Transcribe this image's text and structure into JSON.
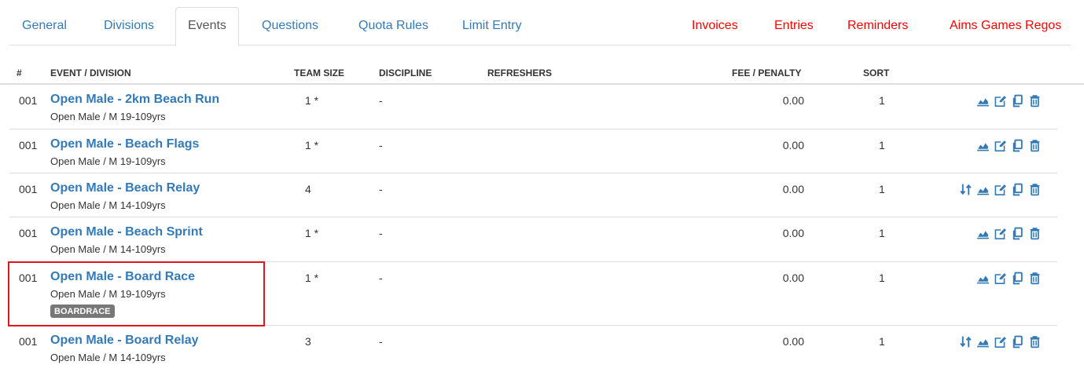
{
  "tabs": [
    {
      "label": "General"
    },
    {
      "label": "Divisions"
    },
    {
      "label": "Events"
    },
    {
      "label": "Questions"
    },
    {
      "label": "Quota Rules"
    },
    {
      "label": "Limit Entry"
    }
  ],
  "right_tabs": [
    {
      "label": "Invoices"
    },
    {
      "label": "Entries"
    },
    {
      "label": "Reminders"
    },
    {
      "label": "Aims Games Regos"
    }
  ],
  "table": {
    "headers": {
      "num": "#",
      "event": "EVENT / DIVISION",
      "team_size": "TEAM SIZE",
      "discipline": "DISCIPLINE",
      "refreshers": "REFRESHERS",
      "fee": "FEE / PENALTY",
      "sort": "SORT"
    },
    "rows": [
      {
        "num": "001",
        "name": "Open Male - 2km Beach Run",
        "division": "Open Male / M 19-109yrs",
        "team_size": "1 *",
        "discipline": "-",
        "fee": "0.00",
        "sort": "1",
        "badge": "",
        "icons": [
          "chart-icon",
          "edit-icon",
          "copy-icon",
          "trash-icon"
        ]
      },
      {
        "num": "001",
        "name": "Open Male - Beach Flags",
        "division": "Open Male / M 19-109yrs",
        "team_size": "1 *",
        "discipline": "-",
        "fee": "0.00",
        "sort": "1",
        "badge": "",
        "icons": [
          "chart-icon",
          "edit-icon",
          "copy-icon",
          "trash-icon"
        ]
      },
      {
        "num": "001",
        "name": "Open Male - Beach Relay",
        "division": "Open Male / M 14-109yrs",
        "team_size": "4",
        "discipline": "-",
        "fee": "0.00",
        "sort": "1",
        "badge": "",
        "icons": [
          "sort-icon",
          "chart-icon",
          "edit-icon",
          "copy-icon",
          "trash-icon"
        ]
      },
      {
        "num": "001",
        "name": "Open Male - Beach Sprint",
        "division": "Open Male / M 14-109yrs",
        "team_size": "1 *",
        "discipline": "-",
        "fee": "0.00",
        "sort": "1",
        "badge": "",
        "icons": [
          "chart-icon",
          "edit-icon",
          "copy-icon",
          "trash-icon"
        ]
      },
      {
        "num": "001",
        "name": "Open Male - Board Race",
        "division": "Open Male / M 19-109yrs",
        "team_size": "1 *",
        "discipline": "-",
        "fee": "0.00",
        "sort": "1",
        "badge": "BOARDRACE",
        "icons": [
          "chart-icon",
          "edit-icon",
          "copy-icon",
          "trash-icon"
        ]
      },
      {
        "num": "001",
        "name": "Open Male - Board Relay",
        "division": "Open Male / M 14-109yrs",
        "team_size": "3",
        "discipline": "-",
        "fee": "0.00",
        "sort": "1",
        "badge": "",
        "icons": [
          "sort-icon",
          "chart-icon",
          "edit-icon",
          "copy-icon",
          "trash-icon"
        ]
      }
    ]
  },
  "colors": {
    "link": "#337ab7",
    "alert_tab": "#ff0000",
    "badge": "#777777",
    "highlight": "#e0161d"
  }
}
